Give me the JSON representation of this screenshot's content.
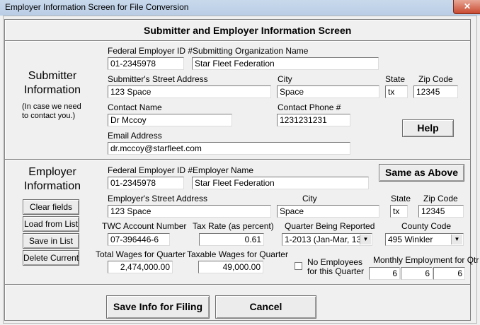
{
  "window": {
    "title": "Employer Information Screen for File Conversion",
    "close": "✕"
  },
  "header": {
    "title": "Submitter and Employer Information Screen"
  },
  "submitter": {
    "section_title": "Submitter\nInformation",
    "note": "(In case we need\nto contact you.)",
    "fein_label": "Federal Employer ID #",
    "fein": "01-2345978",
    "org_label": "Submitting Organization Name",
    "org": "Star Fleet Federation",
    "street_label": "Submitter's Street Address",
    "street": "123 Space",
    "city_label": "City",
    "city": "Space",
    "state_label": "State",
    "state": "tx",
    "zip_label": "Zip Code",
    "zip": "12345",
    "contact_label": "Contact Name",
    "contact": "Dr Mccoy",
    "phone_label": "Contact Phone #",
    "phone": "1231231231",
    "email_label": "Email Address",
    "email": "dr.mccoy@starfleet.com",
    "help_button": "Help"
  },
  "employer": {
    "section_title": "Employer\nInformation",
    "fein_label": "Federal Employer ID #",
    "fein": "01-2345978",
    "name_label": "Employer Name",
    "name": "Star Fleet Federation",
    "same_button": "Same as Above",
    "street_label": "Employer's Street Address",
    "street": "123 Space",
    "city_label": "City",
    "city": "Space",
    "state_label": "State",
    "state": "tx",
    "zip_label": "Zip Code",
    "zip": "12345",
    "twc_label": "TWC Account Number",
    "twc": "07-396446-6",
    "tax_label": "Tax Rate (as percent)",
    "tax": "0.61",
    "quarter_label": "Quarter Being Reported",
    "quarter": "1-2013  (Jan-Mar, 13)",
    "county_label": "County Code",
    "county": "495 Winkler",
    "total_wages_label": "Total Wages for Quarter",
    "total_wages": "2,474,000.00",
    "taxable_wages_label": "Taxable Wages for Quarter",
    "taxable_wages": "49,000.00",
    "no_employees_label": "No Employees\nfor this Quarter",
    "monthly_label": "Monthly Employment for Qtr",
    "monthly": [
      "6",
      "6",
      "6"
    ]
  },
  "list_buttons": {
    "clear": "Clear fields",
    "load": "Load from List",
    "save": "Save in List",
    "delete": "Delete Current"
  },
  "footer": {
    "save_filing": "Save Info for Filing",
    "cancel": "Cancel"
  }
}
